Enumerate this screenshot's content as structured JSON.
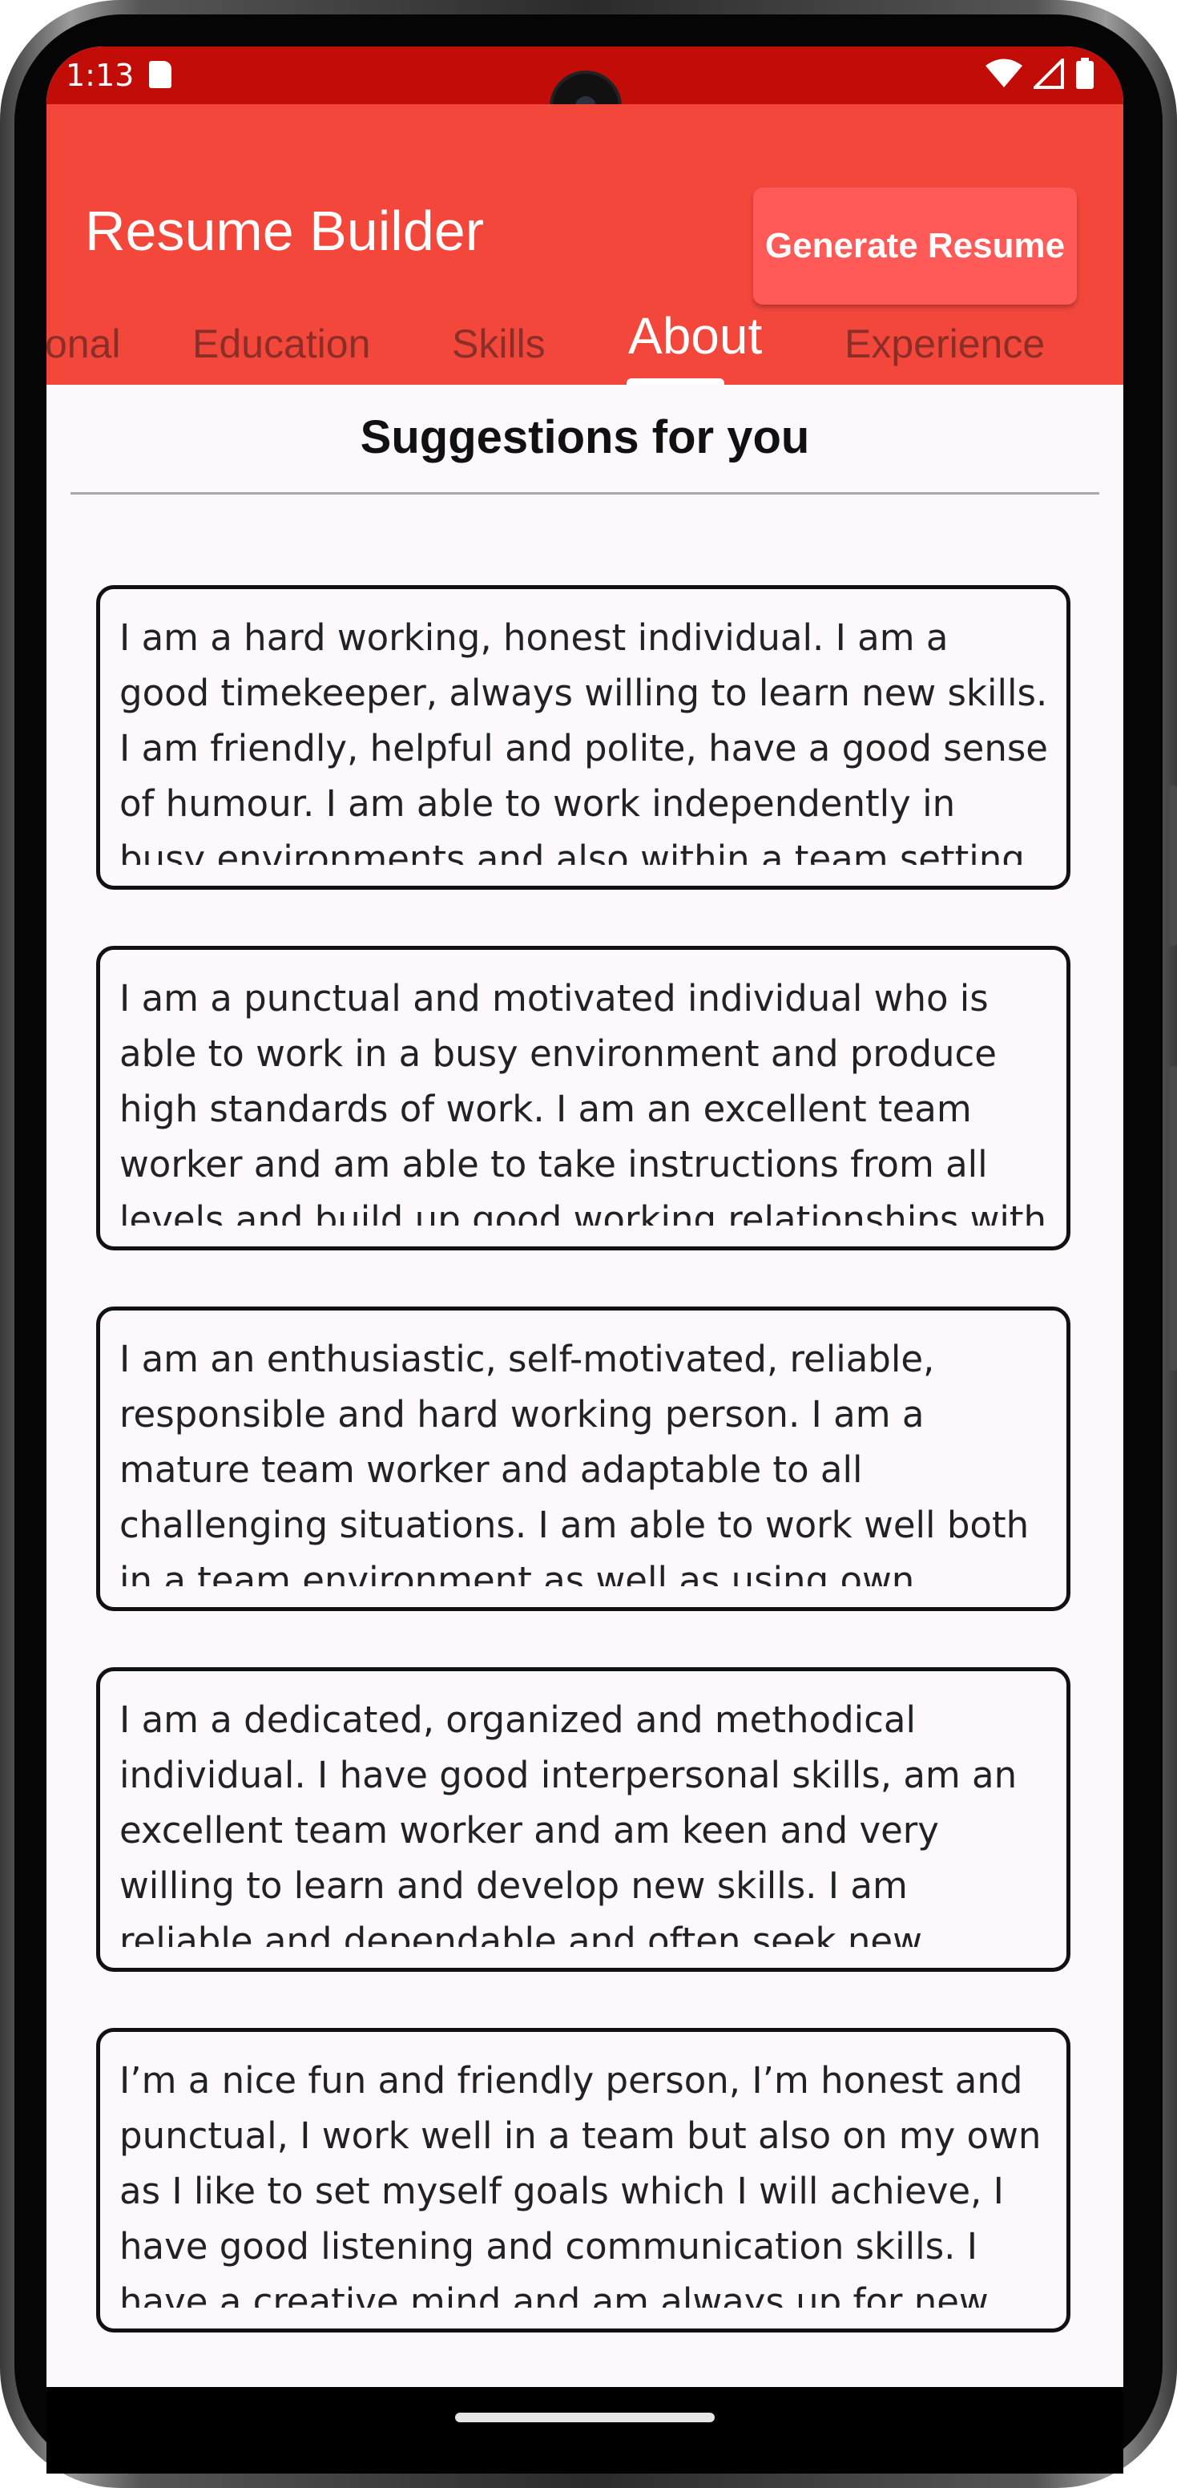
{
  "status_bar": {
    "time": "1:13",
    "icons": [
      "sd-card-icon",
      "wifi-icon",
      "signal-icon",
      "battery-icon"
    ]
  },
  "app_bar": {
    "title": "Resume Builder",
    "generate_button": "Generate Resume"
  },
  "tabs": [
    {
      "label": "onal",
      "active": false
    },
    {
      "label": "Education",
      "active": false
    },
    {
      "label": "Skills",
      "active": false
    },
    {
      "label": "About",
      "active": true
    },
    {
      "label": "Experience",
      "active": false
    }
  ],
  "section": {
    "title": "Suggestions for you"
  },
  "suggestions": [
    "I am a hard working, honest individual. I am a good timekeeper, always willing to learn new skills. I am friendly, helpful and polite, have a good sense of humour. I am able to work independently in busy environments and also within a team setting.",
    "I am a punctual and motivated individual who is able to work in a busy environment and produce high standards of work. I am an excellent team worker and am able to take instructions from all levels and build up good working relationships with all",
    "I am an enthusiastic, self-motivated, reliable, responsible and hard working person. I am a mature team worker and adaptable to all challenging situations. I am able to work well both in a team environment as well as using own initiative.",
    "I am a dedicated, organized and methodical individual. I have good interpersonal skills, am an excellent team worker and am keen and very willing to learn and develop new skills. I am reliable and dependable and often seek new responsibilities",
    "I’m a nice fun and friendly person, I’m honest and punctual, I work well in a team but also on my own as I like to set myself goals which I will achieve, I have good listening and communication skills. I have a creative mind and am always up for new"
  ],
  "colors": {
    "status_bar": "#c10c08",
    "app_bar": "#f4473c",
    "button": "#ff5a57",
    "tab_inactive": "#8b2e27",
    "background": "#fdf8fb"
  }
}
